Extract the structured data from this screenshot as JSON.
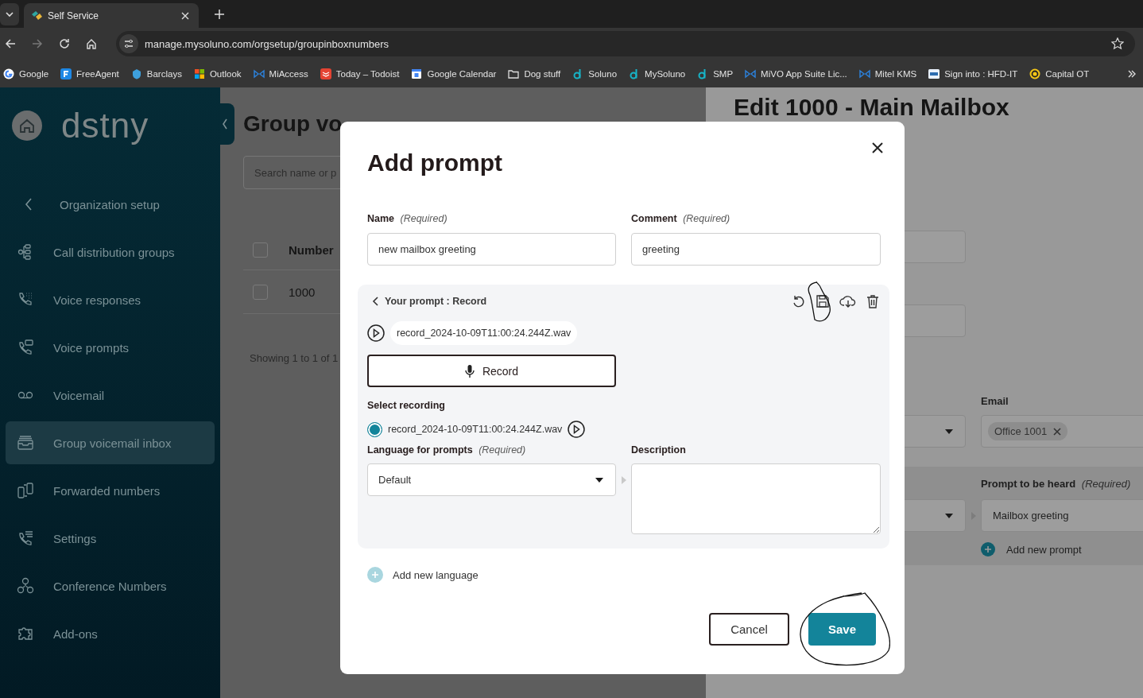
{
  "browser": {
    "tabs": [
      {
        "title": "Self Service",
        "selected": true
      }
    ],
    "address": "manage.mysoluno.com/orgsetup/groupinboxnumbers",
    "bookmarks": [
      {
        "label": "Google",
        "kind": "g"
      },
      {
        "label": "FreeAgent",
        "kind": "fa"
      },
      {
        "label": "Barclays",
        "kind": "shield"
      },
      {
        "label": "Outlook",
        "kind": "ms"
      },
      {
        "label": "MiAccess",
        "kind": "bowtie"
      },
      {
        "label": "Today – Todoist",
        "kind": "todo"
      },
      {
        "label": "Google Calendar",
        "kind": "cal"
      },
      {
        "label": "Dog stuff",
        "kind": "folder"
      },
      {
        "label": "Soluno",
        "kind": "d"
      },
      {
        "label": "MySoluno",
        "kind": "d"
      },
      {
        "label": "SMP",
        "kind": "d"
      },
      {
        "label": "MiVO App Suite Lic...",
        "kind": "bowtie"
      },
      {
        "label": "Mitel KMS",
        "kind": "bowtie"
      },
      {
        "label": "Sign into : HFD-IT",
        "kind": "hfd"
      },
      {
        "label": "Capital OT",
        "kind": "coin"
      }
    ]
  },
  "sidebar": {
    "logo": "dstny",
    "items": [
      {
        "label": "Organization setup",
        "kind": "back",
        "selected": false
      },
      {
        "label": "Call distribution groups",
        "kind": "org",
        "selected": false
      },
      {
        "label": "Voice responses",
        "kind": "ivr",
        "selected": false
      },
      {
        "label": "Voice prompts",
        "kind": "prompt",
        "selected": false
      },
      {
        "label": "Voicemail",
        "kind": "voicemail",
        "selected": false
      },
      {
        "label": "Group voicemail inbox",
        "kind": "inbox",
        "selected": true
      },
      {
        "label": "Forwarded numbers",
        "kind": "forward",
        "selected": false
      },
      {
        "label": "Settings",
        "kind": "settings",
        "selected": false
      },
      {
        "label": "Conference Numbers",
        "kind": "conference",
        "selected": false
      },
      {
        "label": "Add-ons",
        "kind": "addons",
        "selected": false
      }
    ]
  },
  "page": {
    "title": "Group vo",
    "search": {
      "placeholder": "Search name or p"
    },
    "table": {
      "columns": [
        "Number"
      ],
      "header_checked": false,
      "rows": [
        {
          "cells": [
            "1000"
          ],
          "checked": false
        }
      ]
    },
    "footer": "Showing 1 to 1 of 1"
  },
  "drawer": {
    "title": "Edit 1000 - Main Mailbox",
    "email": {
      "label": "Email",
      "chips": [
        "Office 1001"
      ]
    },
    "prompt": {
      "label": "Prompt to be heard",
      "note": "(Required)",
      "value": "Mailbox greeting",
      "add": "Add new prompt"
    }
  },
  "modal": {
    "title": "Add prompt",
    "fields": [
      {
        "label": "Name",
        "note": "(Required)",
        "value": "new mailbox greeting"
      },
      {
        "label": "Comment",
        "note": "(Required)",
        "value": "greeting"
      }
    ],
    "prompt_panel": {
      "heading": "Your prompt : Record",
      "file": "record_2024-10-09T11:00:24.244Z.wav",
      "record_button": "Record",
      "select_label": "Select recording",
      "recordings": [
        {
          "file": "record_2024-10-09T11:00:24.244Z.wav",
          "selected": true
        }
      ],
      "language": {
        "label": "Language for prompts",
        "note": "(Required)",
        "value": "Default"
      },
      "description": {
        "label": "Description"
      }
    },
    "add_language": "Add new language",
    "buttons": [
      {
        "label": "Cancel",
        "kind": "secondary"
      },
      {
        "label": "Save",
        "kind": "primary"
      }
    ]
  }
}
